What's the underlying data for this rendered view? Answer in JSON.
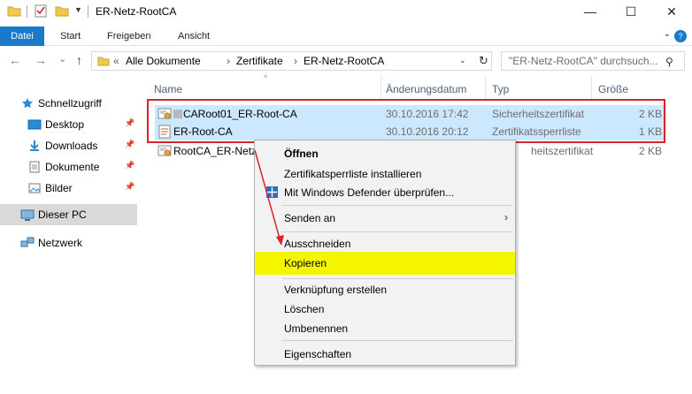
{
  "window": {
    "title": "ER-Netz-RootCA",
    "minimize_glyph": "—",
    "maximize_glyph": "☐",
    "close_glyph": "✕"
  },
  "ribbon": {
    "tabs": [
      "Datei",
      "Start",
      "Freigeben",
      "Ansicht"
    ],
    "accent": "#1979ca"
  },
  "nav": {
    "back_glyph": "←",
    "forward_glyph": "→",
    "recent_glyph": "⌄",
    "up_glyph": "↑",
    "breadcrumb": [
      "«",
      "Alle Dokumente",
      "›",
      "Zertifikate",
      "›",
      "ER-Netz-RootCA"
    ],
    "search_placeholder": "\"ER-Netz-RootCA\" durchsuch..."
  },
  "sidebar": {
    "items": [
      {
        "label": "Schnellzugriff",
        "icon": "star-icon"
      },
      {
        "label": "Desktop",
        "icon": "desktop-icon"
      },
      {
        "label": "Downloads",
        "icon": "download-icon"
      },
      {
        "label": "Dokumente",
        "icon": "documents-icon"
      },
      {
        "label": "Bilder",
        "icon": "pictures-icon"
      },
      {
        "label": "Dieser PC",
        "icon": "computer-icon"
      },
      {
        "label": "Netzwerk",
        "icon": "network-icon"
      }
    ]
  },
  "columns": [
    "Name",
    "Änderungsdatum",
    "Typ",
    "Größe"
  ],
  "files": [
    {
      "name": "CARoot01_ER-Root-CA",
      "date": "30.10.2016 17:42",
      "type": "Sicherheitszertifikat",
      "size": "2 KB",
      "icon": "certificate-icon"
    },
    {
      "name": "ER-Root-CA",
      "date": "30.10.2016 20:12",
      "type": "Zertifikatssperrliste",
      "size": "1 KB",
      "icon": "crl-icon"
    },
    {
      "name": "RootCA_ER-Netz",
      "date": "",
      "type": "heitszertifikat",
      "size": "2 KB",
      "icon": "certificate-icon"
    }
  ],
  "context_menu": {
    "items": [
      "Öffnen",
      "Zertifikatsperrliste installieren",
      "Mit Windows Defender überprüfen...",
      "Senden an",
      "Ausschneiden",
      "Kopieren",
      "Verknüpfung erstellen",
      "Löschen",
      "Umbenennen",
      "Eigenschaften"
    ],
    "submenu_glyph": "›",
    "highlight": "#f5f500"
  },
  "annotation": {
    "box_color": "#d9232b"
  }
}
